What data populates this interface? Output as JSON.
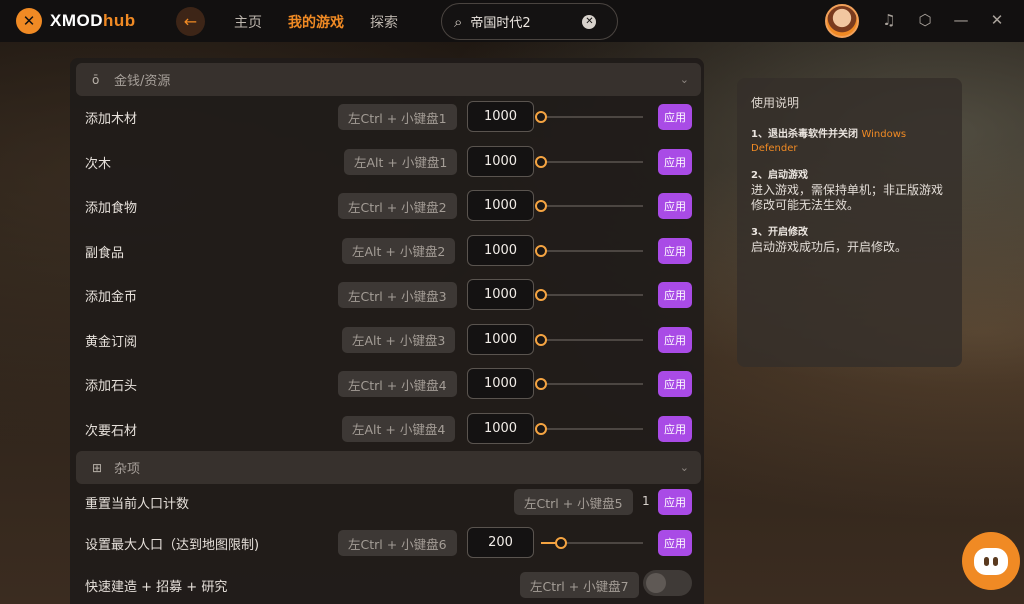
{
  "app": {
    "logo_mark": "✕",
    "logo_text_main": "XMOD",
    "logo_text_hub": "hub"
  },
  "nav": {
    "back_icon": "arrow-left-icon",
    "items": [
      {
        "label": "主页",
        "active": false
      },
      {
        "label": "我的游戏",
        "active": true
      },
      {
        "label": "探索",
        "active": false
      }
    ]
  },
  "search": {
    "value": "帝国时代2",
    "icon": "search-icon",
    "clear_icon": "close-icon"
  },
  "top_icons": [
    "notification-icon",
    "settings-icon",
    "minimize-icon",
    "collapse-icon"
  ],
  "sections": [
    {
      "title": "金钱/资源",
      "icon": "money-bag-icon",
      "rows": [
        {
          "label": "添加木材",
          "hotkey": "左Ctrl + 小键盘1",
          "value": "1000",
          "slider": 0.0,
          "apply": "应用"
        },
        {
          "label": "次木",
          "hotkey": "左Alt + 小键盘1",
          "value": "1000",
          "slider": 0.0,
          "apply": "应用"
        },
        {
          "label": "添加食物",
          "hotkey": "左Ctrl + 小键盘2",
          "value": "1000",
          "slider": 0.0,
          "apply": "应用"
        },
        {
          "label": "副食品",
          "hotkey": "左Alt + 小键盘2",
          "value": "1000",
          "slider": 0.0,
          "apply": "应用"
        },
        {
          "label": "添加金币",
          "hotkey": "左Ctrl + 小键盘3",
          "value": "1000",
          "slider": 0.0,
          "apply": "应用"
        },
        {
          "label": "黄金订阅",
          "hotkey": "左Alt + 小键盘3",
          "value": "1000",
          "slider": 0.0,
          "apply": "应用"
        },
        {
          "label": "添加石头",
          "hotkey": "左Ctrl + 小键盘4",
          "value": "1000",
          "slider": 0.0,
          "apply": "应用"
        },
        {
          "label": "次要石材",
          "hotkey": "左Alt + 小键盘4",
          "value": "1000",
          "slider": 0.0,
          "apply": "应用"
        }
      ]
    },
    {
      "title": "杂项",
      "icon": "grid-icon",
      "rows": [
        {
          "label": "重置当前人口计数",
          "hotkey": "左Ctrl + 小键盘5",
          "value": "1",
          "apply": "应用"
        },
        {
          "label": "设置最大人口（达到地图限制)",
          "hotkey": "左Ctrl + 小键盘6",
          "value": "200",
          "slider": 0.2,
          "apply": "应用"
        },
        {
          "label": "快速建造 + 招募 + 研究",
          "hotkey": "左Ctrl + 小键盘7",
          "toggle": false
        }
      ]
    }
  ],
  "info": {
    "title": "使用说明",
    "step1_head": "1、退出杀毒软件并关闭",
    "step1_accent": "Windows Defender",
    "step2_head": "2、启动游戏",
    "step2_body": "进入游戏，需保持单机；非正版游戏修改可能无法生效。",
    "step3_head": "3、开启修改",
    "step3_body": "启动游戏成功后，开启修改。"
  },
  "helper_icon": "chat-assistant-icon",
  "colors": {
    "accent": "#f08a24",
    "apply": "#a94be6",
    "slider": "#f5a442"
  }
}
